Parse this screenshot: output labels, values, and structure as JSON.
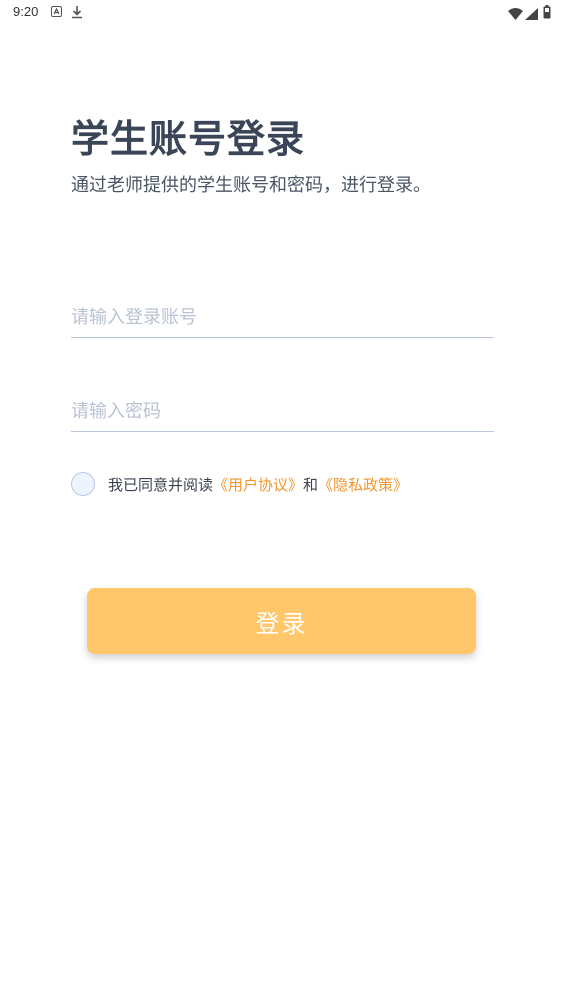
{
  "status_bar": {
    "time": "9:20",
    "icons": [
      "notification-a-icon",
      "download-icon",
      "wifi-icon",
      "signal-icon",
      "battery-icon"
    ]
  },
  "header": {
    "title": "学生账号登录",
    "subtitle": "通过老师提供的学生账号和密码，进行登录。"
  },
  "form": {
    "account_placeholder": "请输入登录账号",
    "account_value": "",
    "password_placeholder": "请输入密码",
    "password_value": ""
  },
  "agreement": {
    "checked": false,
    "prefix": "我已同意并阅读",
    "user_agreement": "《用户协议》",
    "conjunction": "和",
    "privacy_policy": "《隐私政策》"
  },
  "login_button": {
    "label": "登录"
  },
  "colors": {
    "title": "#3a4658",
    "accent_link": "#f0962e",
    "button_bg": "#ffc76a",
    "underline": "#b9c6de"
  }
}
